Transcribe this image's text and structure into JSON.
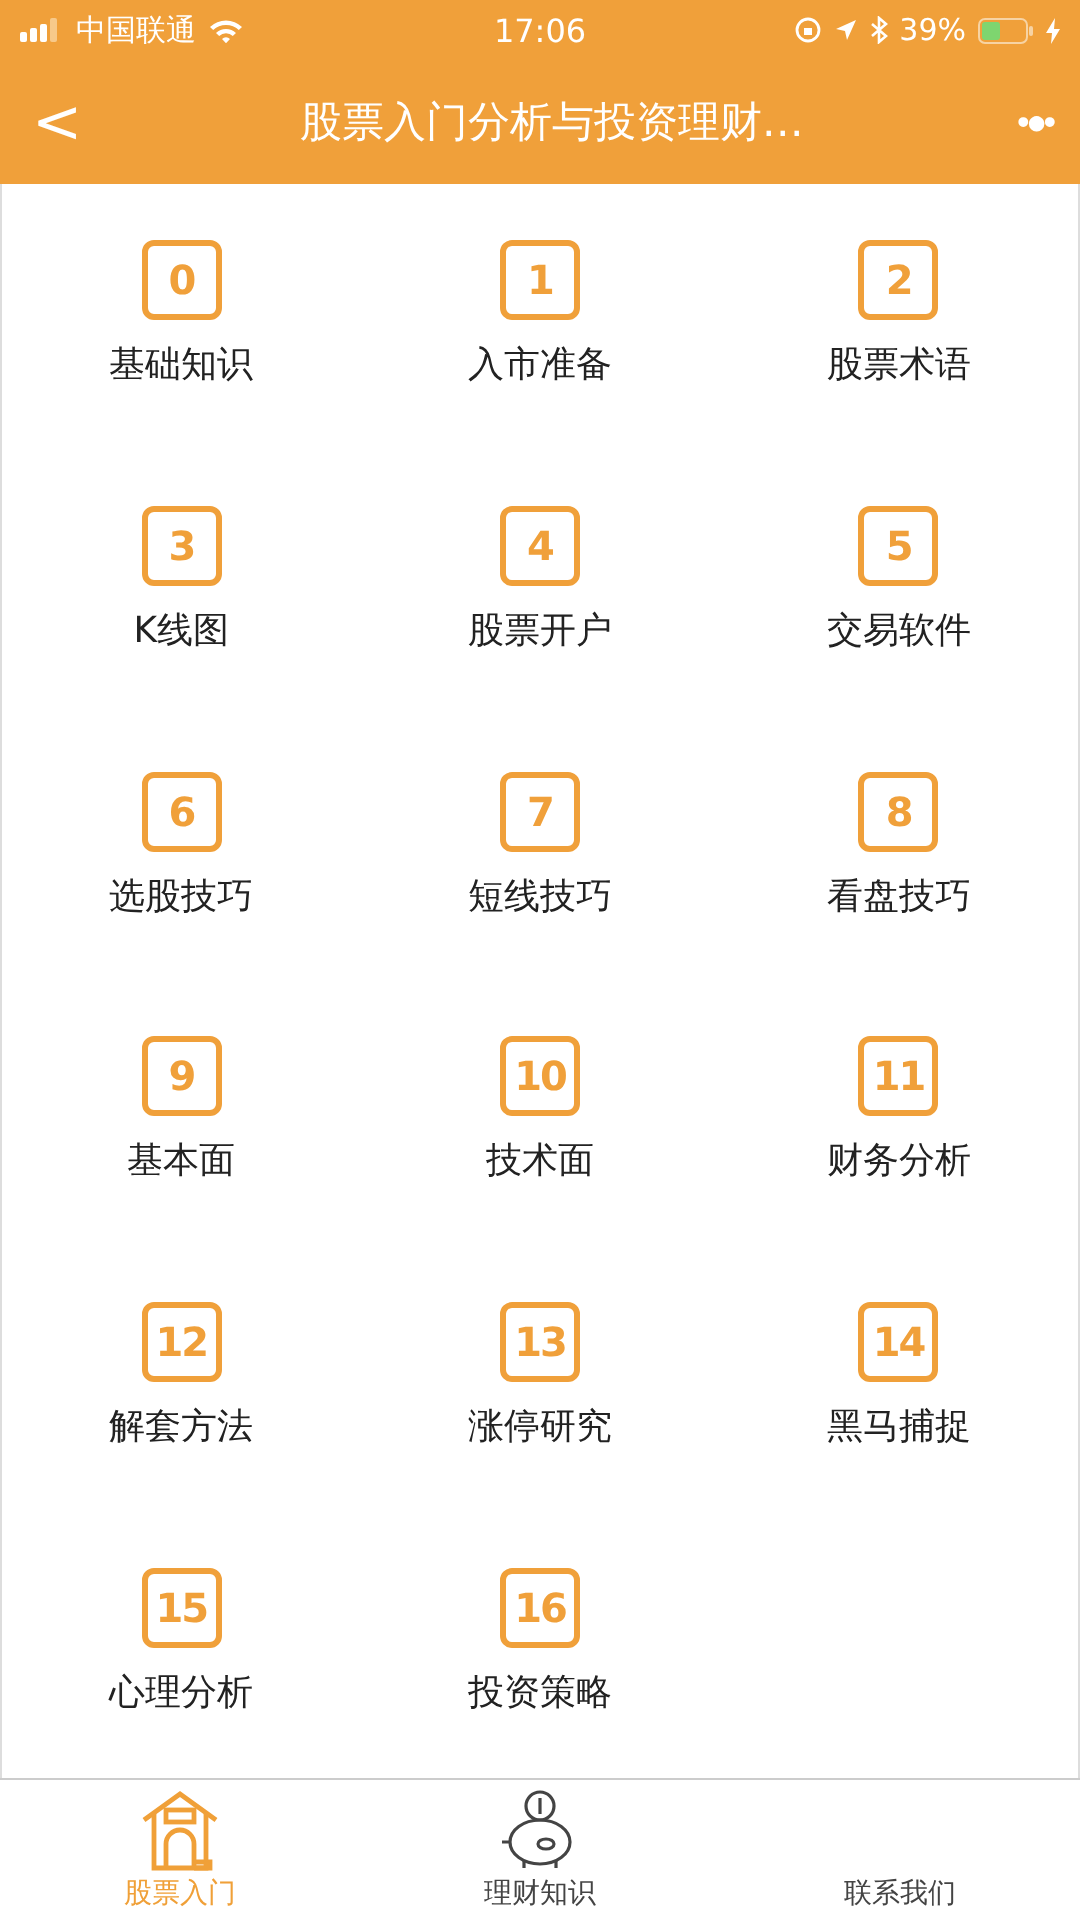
{
  "status_bar": {
    "carrier": "中国联通",
    "time": "17:06",
    "battery": "39%"
  },
  "nav_bar": {
    "back": "<",
    "title": "股票入门分析与投资理财…",
    "more": "•●•"
  },
  "topics": [
    {
      "number": "0",
      "label": "基础知识"
    },
    {
      "number": "1",
      "label": "入市准备"
    },
    {
      "number": "2",
      "label": "股票术语"
    },
    {
      "number": "3",
      "label": "K线图"
    },
    {
      "number": "4",
      "label": "股票开户"
    },
    {
      "number": "5",
      "label": "交易软件"
    },
    {
      "number": "6",
      "label": "选股技巧"
    },
    {
      "number": "7",
      "label": "短线技巧"
    },
    {
      "number": "8",
      "label": "看盘技巧"
    },
    {
      "number": "9",
      "label": "基本面"
    },
    {
      "number": "10",
      "label": "技术面"
    },
    {
      "number": "11",
      "label": "财务分析"
    },
    {
      "number": "12",
      "label": "解套方法"
    },
    {
      "number": "13",
      "label": "涨停研究"
    },
    {
      "number": "14",
      "label": "黑马捕捉"
    },
    {
      "number": "15",
      "label": "心理分析"
    },
    {
      "number": "16",
      "label": "投资策略"
    }
  ],
  "tab_bar": [
    {
      "kind": "house",
      "label": "股票入门",
      "selected": true
    },
    {
      "kind": "piggy",
      "label": "理财知识",
      "selected": false
    },
    {
      "kind": "hidden",
      "label": "联系我们",
      "selected": false
    }
  ]
}
